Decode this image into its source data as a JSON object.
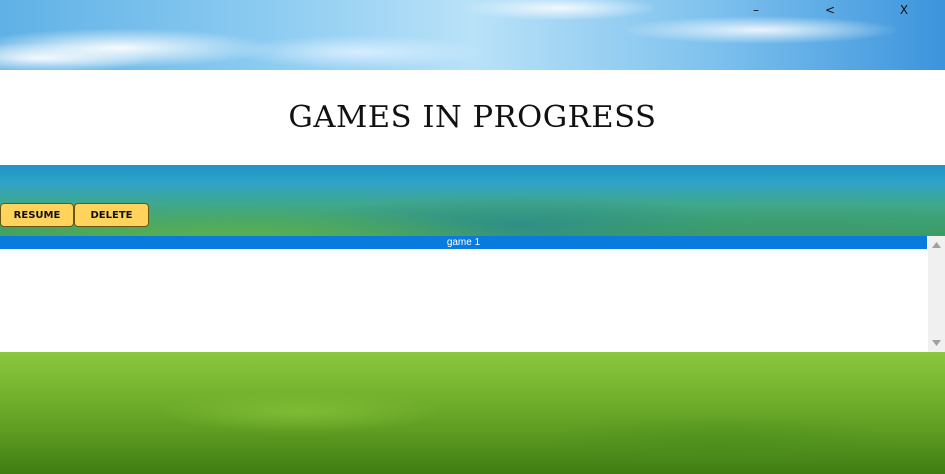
{
  "window": {
    "minimize_label": "–",
    "back_label": "<",
    "close_label": "X"
  },
  "header": {
    "title": "GAMES IN PROGRESS"
  },
  "actions": {
    "resume_label": "RESUME",
    "delete_label": "DELETE"
  },
  "games_list": {
    "items": [
      {
        "label": "game 1",
        "selected": true
      }
    ]
  },
  "colors": {
    "button_fill": "#ffd35c",
    "selection": "#0a7bde",
    "title_band": "#ffffff"
  },
  "icons": {
    "scroll_up": "scroll-up-arrow-icon",
    "scroll_down": "scroll-down-arrow-icon"
  }
}
